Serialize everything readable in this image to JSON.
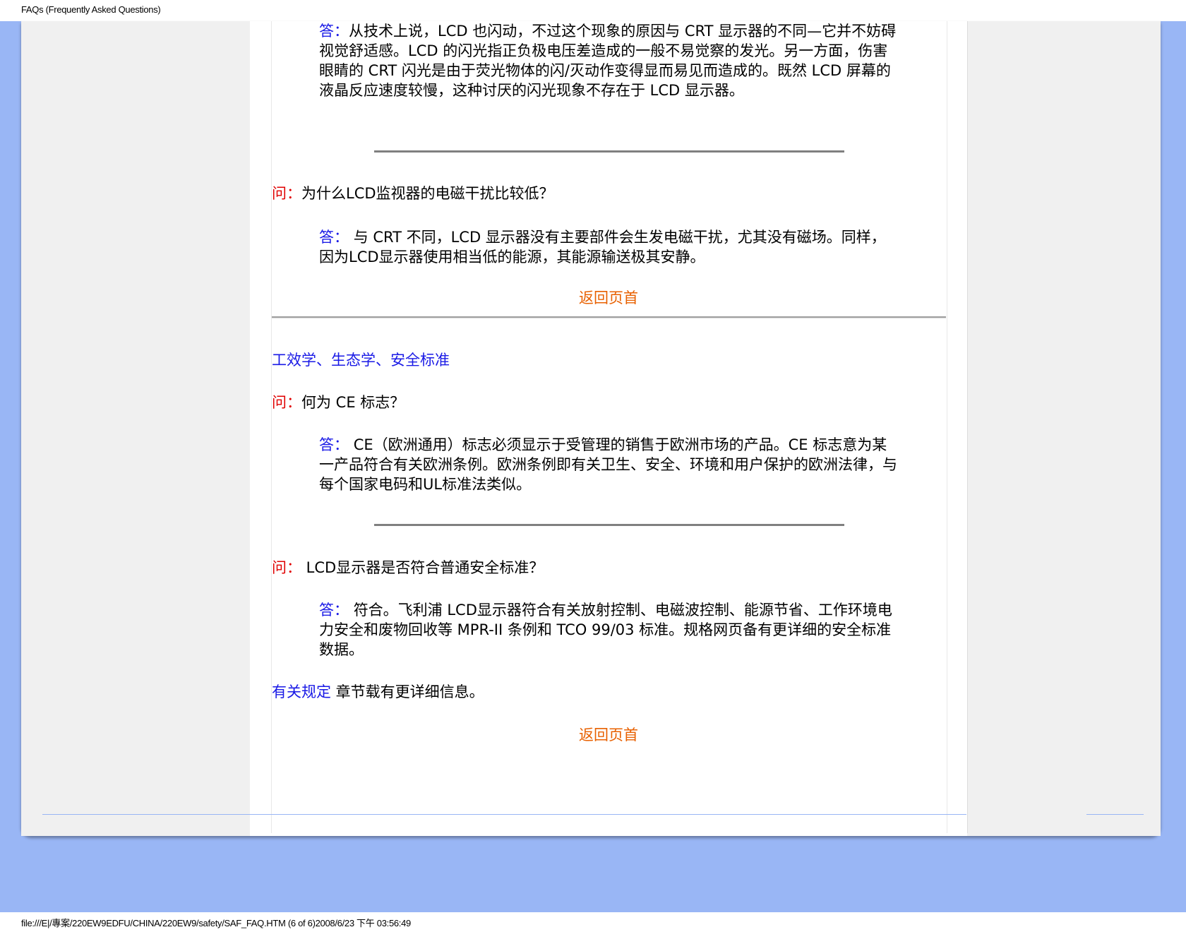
{
  "header": {
    "title": "FAQs (Frequently Asked Questions)"
  },
  "footer": {
    "status": "file:///E|/專案/220EW9EDFU/CHINA/220EW9/safety/SAF_FAQ.HTM (6 of 6)2008/6/23 下午 03:56:49"
  },
  "labels": {
    "q": "问：",
    "a": "答：",
    "a_spaced": "答： "
  },
  "faq": [
    {
      "answer": "从技术上说，LCD 也闪动，不过这个现象的原因与 CRT 显示器的不同—它并不妨碍视觉舒适感。LCD 的闪光指正负极电压差造成的一般不易觉察的发光。另一方面，伤害眼睛的 CRT 闪光是由于荧光物体的闪/灭动作变得显而易见而造成的。既然 LCD 屏幕的液晶反应速度较慢，这种讨厌的闪光现象不存在于 LCD 显示器。"
    },
    {
      "question": "为什么LCD监视器的电磁干扰比较低？",
      "answer": "与 CRT 不同，LCD 显示器没有主要部件会生发电磁干扰，尤其没有磁场。同样，因为LCD显示器使用相当低的能源，其能源输送极其安静。"
    }
  ],
  "back_to_top": "返回页首",
  "section_title": "工效学、生态学、安全标准",
  "safety": [
    {
      "question": "何为 CE 标志？",
      "answer": "CE（欧洲通用）标志必须显示于受管理的销售于欧洲市场的产品。CE 标志意为某一产品符合有关欧洲条例。欧洲条例即有关卫生、安全、环境和用户保护的欧洲法律，与每个国家电码和UL标准法类似。"
    },
    {
      "question": " LCD显示器是否符合普通安全标准？",
      "answer": "符合。飞利浦 LCD显示器符合有关放射控制、电磁波控制、能源节省、工作环境电力安全和废物回收等 MPR-II 条例和 TCO 99/03 标准。规格网页备有更详细的安全标准数据。"
    }
  ],
  "regulatory": {
    "link": "有关规定",
    "text": " 章节载有更详细信息。"
  }
}
